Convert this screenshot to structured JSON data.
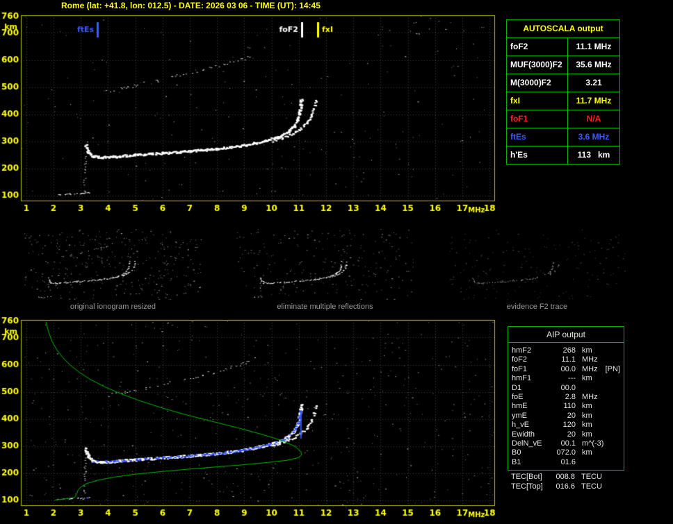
{
  "title": "Rome (lat: +41.8, lon: 012.5) - DATE: 2026 03 06 - TIME (UT): 14:45",
  "autoscala_table": {
    "header": "AUTOSCALA output",
    "rows": [
      {
        "param": "foF2",
        "value": "11.1 MHz",
        "color": "#ffffff"
      },
      {
        "param": "MUF(3000)F2",
        "value": "35.6 MHz",
        "color": "#ffffff"
      },
      {
        "param": "M(3000)F2",
        "value": "3.21",
        "color": "#ffffff"
      },
      {
        "param": "fxI",
        "value": "11.7 MHz",
        "color": "#ffff00"
      },
      {
        "param": "foF1",
        "value": "N/A",
        "color": "#ff2020"
      },
      {
        "param": "ftEs",
        "value": "3.6 MHz",
        "color": "#3b5bff"
      },
      {
        "param": "h'Es",
        "value": "113   km",
        "color": "#ffffff"
      }
    ]
  },
  "aip_table": {
    "header": "AIP output",
    "rows": [
      {
        "param": "hmF2",
        "value": "268",
        "unit": "km"
      },
      {
        "param": "foF2",
        "value": "11.1",
        "unit": "MHz"
      },
      {
        "param": "foF1",
        "value": "00.0",
        "unit": "MHz",
        "note": "[PN]"
      },
      {
        "param": "hmF1",
        "value": "---",
        "unit": "km"
      },
      {
        "param": "D1",
        "value": "00.0",
        "unit": ""
      },
      {
        "param": "foE",
        "value": "2.8",
        "unit": "MHz"
      },
      {
        "param": "hmE",
        "value": "110",
        "unit": "km"
      },
      {
        "param": "ymE",
        "value": "20",
        "unit": "km"
      },
      {
        "param": "h_vE",
        "value": "120",
        "unit": "km"
      },
      {
        "param": "Ewidth",
        "value": "20",
        "unit": "km"
      },
      {
        "param": "DelN_vE",
        "value": "00.1",
        "unit": "m^(-3)"
      },
      {
        "param": "B0",
        "value": "072.0",
        "unit": "km"
      },
      {
        "param": "B1",
        "value": "01.6",
        "unit": ""
      }
    ],
    "tec_rows": [
      {
        "param": "TEC[Bot]",
        "value": "008.8",
        "unit": "TECU"
      },
      {
        "param": "TEC[Top]",
        "value": "016.6",
        "unit": "TECU"
      }
    ]
  },
  "thumbnails": [
    {
      "caption": "original ionogram resized"
    },
    {
      "caption": "eliminate multiple reflections"
    },
    {
      "caption": "evidence F2 trace"
    }
  ],
  "trace_lib": {
    "o_trace": [
      [
        3.15,
        292
      ],
      [
        3.25,
        264
      ],
      [
        3.42,
        247
      ],
      [
        3.75,
        243
      ],
      [
        4.2,
        246
      ],
      [
        5.0,
        252
      ],
      [
        6.0,
        259
      ],
      [
        7.0,
        266
      ],
      [
        8.0,
        275
      ],
      [
        8.8,
        285
      ],
      [
        9.4,
        296
      ],
      [
        9.9,
        308
      ],
      [
        10.3,
        322
      ],
      [
        10.6,
        338
      ],
      [
        10.8,
        358
      ],
      [
        10.93,
        382
      ],
      [
        11.0,
        408
      ],
      [
        11.05,
        438
      ],
      [
        11.07,
        456
      ]
    ],
    "x_trace": [
      [
        10.0,
        303
      ],
      [
        10.4,
        316
      ],
      [
        10.75,
        331
      ],
      [
        11.05,
        349
      ],
      [
        11.28,
        370
      ],
      [
        11.44,
        395
      ],
      [
        11.54,
        424
      ],
      [
        11.6,
        452
      ]
    ],
    "second_hop": [
      [
        3.9,
        486
      ],
      [
        4.6,
        500
      ],
      [
        5.4,
        516
      ],
      [
        6.2,
        534
      ],
      [
        7.0,
        552
      ],
      [
        7.7,
        570
      ],
      [
        8.4,
        589
      ],
      [
        9.0,
        607
      ],
      [
        9.35,
        624
      ]
    ],
    "es_trace": [
      [
        2.15,
        106
      ],
      [
        2.6,
        108
      ],
      [
        3.05,
        110
      ],
      [
        3.35,
        113
      ]
    ],
    "es_vertical": [
      [
        3.1,
        102
      ],
      [
        3.14,
        200
      ],
      [
        3.18,
        296
      ]
    ],
    "blue_fit": [
      [
        3.4,
        245
      ],
      [
        4.2,
        246
      ],
      [
        5.0,
        252
      ],
      [
        6.0,
        259
      ],
      [
        7.0,
        266
      ],
      [
        8.0,
        275
      ],
      [
        8.8,
        285
      ],
      [
        9.4,
        296
      ],
      [
        9.9,
        308
      ],
      [
        10.3,
        322
      ],
      [
        10.6,
        338
      ],
      [
        10.8,
        358
      ],
      [
        10.93,
        382
      ],
      [
        11.0,
        408
      ],
      [
        11.04,
        430
      ]
    ],
    "blue_asymptote": [
      [
        11.08,
        328
      ],
      [
        11.08,
        432
      ]
    ],
    "blue_es": [
      [
        2.35,
        108
      ],
      [
        2.9,
        110
      ],
      [
        3.3,
        112
      ]
    ],
    "green_profile": [
      [
        1.72,
        758
      ],
      [
        1.82,
        720
      ],
      [
        1.95,
        685
      ],
      [
        2.12,
        655
      ],
      [
        2.35,
        625
      ],
      [
        2.62,
        598
      ],
      [
        2.95,
        572
      ],
      [
        3.35,
        546
      ],
      [
        3.85,
        520
      ],
      [
        4.45,
        494
      ],
      [
        5.15,
        468
      ],
      [
        5.95,
        442
      ],
      [
        6.85,
        416
      ],
      [
        7.8,
        392
      ],
      [
        8.75,
        368
      ],
      [
        9.6,
        345
      ],
      [
        10.35,
        322
      ],
      [
        10.85,
        300
      ],
      [
        11.08,
        280
      ],
      [
        11.1,
        268
      ],
      [
        11.0,
        258
      ],
      [
        10.55,
        248
      ],
      [
        9.85,
        240
      ],
      [
        9.0,
        232
      ],
      [
        8.0,
        224
      ],
      [
        7.0,
        216
      ],
      [
        6.0,
        207
      ],
      [
        5.0,
        197
      ],
      [
        4.2,
        186
      ],
      [
        3.6,
        174
      ],
      [
        3.2,
        162
      ],
      [
        3.0,
        150
      ],
      [
        2.9,
        138
      ],
      [
        2.85,
        125
      ],
      [
        2.78,
        112
      ],
      [
        2.45,
        106
      ],
      [
        2.05,
        102
      ]
    ]
  },
  "chart_data": [
    {
      "id": "main_ionogram",
      "type": "scatter",
      "title": "scaled ionogram with AUTOSCALA characteristics",
      "xlabel": "MHz",
      "ylabel": "km",
      "xlim": [
        0.8,
        18.2
      ],
      "ylim": [
        80,
        765
      ],
      "x_ticks": [
        1,
        2,
        3,
        4,
        5,
        6,
        7,
        8,
        9,
        10,
        11,
        12,
        13,
        14,
        15,
        16,
        17,
        18
      ],
      "y_grid": [
        100,
        200,
        300,
        400,
        500,
        600,
        700
      ],
      "y_labels": [
        760,
        700,
        600,
        500,
        400,
        300,
        200,
        100
      ],
      "grid_color": "#46463c",
      "border_color": "#bcbc00",
      "axis_color": "#ffff00",
      "margins": {
        "l": 30,
        "t": 6,
        "r": 13,
        "b": 26
      },
      "seed": 7,
      "markers": [
        {
          "label": "ftEs",
          "freq": 3.6,
          "color": "#3b5bff",
          "side": "left"
        },
        {
          "label": "foF2",
          "freq": 11.1,
          "color": "#ffffff",
          "side": "left"
        },
        {
          "label": "fxI",
          "freq": 11.7,
          "color": "#ffff00",
          "side": "right"
        }
      ],
      "series": [
        {
          "name": "background-noise",
          "style": "noise",
          "color": "#808080",
          "count": 170
        },
        {
          "name": "background-noise-bright",
          "style": "noise",
          "color": "#d0d0d0",
          "count": 45
        },
        {
          "name": "second-hop-echo",
          "ref": "second_hop",
          "color": "#d8d8d8",
          "size": 2,
          "density": 0.38,
          "jitter": 2.2
        },
        {
          "name": "sporadic-e-trace",
          "ref": "es_trace",
          "color": "#ffffff",
          "size": 2,
          "density": 0.75,
          "jitter": 0.8
        },
        {
          "name": "vertical-scatter",
          "ref": "es_vertical",
          "color": "#cccccc",
          "size": 2,
          "density": 0.4,
          "jitter": 1.8
        },
        {
          "name": "f2-ordinary-trace",
          "ref": "o_trace",
          "color": "#ffffff",
          "size": 3,
          "density": 0.95,
          "jitter": 1.6,
          "passes": 2
        },
        {
          "name": "f2-extraordinary-trace",
          "ref": "x_trace",
          "color": "#ffffff",
          "size": 3,
          "density": 0.85,
          "jitter": 1.4
        }
      ]
    },
    {
      "id": "thumb_original",
      "type": "scatter",
      "title": "original ionogram resized",
      "xlim": [
        0.8,
        18.2
      ],
      "ylim": [
        80,
        765
      ],
      "margins": {
        "l": 0,
        "t": 0,
        "r": 0,
        "b": 0
      },
      "seed": 21,
      "series": [
        {
          "name": "background-noise",
          "style": "noise",
          "color": "#7a7a7a",
          "count": 260
        },
        {
          "name": "background-noise-bright",
          "style": "noise",
          "color": "#c8c8c8",
          "count": 60
        },
        {
          "name": "second-hop-echo",
          "ref": "second_hop",
          "color": "#cfcfcf",
          "size": 1,
          "density": 0.4,
          "jitter": 1.2
        },
        {
          "name": "sporadic-e-trace",
          "ref": "es_trace",
          "color": "#ffffff",
          "size": 1,
          "density": 0.6,
          "jitter": 0.8
        },
        {
          "name": "vertical-scatter",
          "ref": "es_vertical",
          "color": "#cfcfcf",
          "size": 1,
          "density": 0.35,
          "jitter": 1
        },
        {
          "name": "f2-ordinary-trace",
          "ref": "o_trace",
          "color": "#ffffff",
          "size": 2,
          "density": 0.85,
          "jitter": 1
        },
        {
          "name": "f2-extraordinary-trace",
          "ref": "x_trace",
          "color": "#ffffff",
          "size": 2,
          "density": 0.7,
          "jitter": 1
        }
      ]
    },
    {
      "id": "thumb_filtered",
      "type": "scatter",
      "title": "eliminate multiple reflections",
      "xlim": [
        0.8,
        18.2
      ],
      "ylim": [
        80,
        765
      ],
      "margins": {
        "l": 0,
        "t": 0,
        "r": 0,
        "b": 0
      },
      "seed": 22,
      "series": [
        {
          "name": "background-noise",
          "style": "noise",
          "color": "#6f6f6f",
          "count": 180
        },
        {
          "name": "background-noise-bright",
          "style": "noise",
          "color": "#c0c0c0",
          "count": 40
        },
        {
          "name": "sporadic-e-trace",
          "ref": "es_trace",
          "color": "#ffffff",
          "size": 1,
          "density": 0.55,
          "jitter": 0.8
        },
        {
          "name": "vertical-scatter",
          "ref": "es_vertical",
          "color": "#bbbbbb",
          "size": 1,
          "density": 0.25,
          "jitter": 1
        },
        {
          "name": "f2-ordinary-trace",
          "ref": "o_trace",
          "color": "#ffffff",
          "size": 2,
          "density": 0.85,
          "jitter": 1
        },
        {
          "name": "f2-extraordinary-trace",
          "ref": "x_trace",
          "color": "#ffffff",
          "size": 2,
          "density": 0.7,
          "jitter": 1
        }
      ]
    },
    {
      "id": "thumb_f2",
      "type": "scatter",
      "title": "evidence F2 trace",
      "xlim": [
        0.8,
        18.2
      ],
      "ylim": [
        80,
        765
      ],
      "margins": {
        "l": 0,
        "t": 0,
        "r": 0,
        "b": 0
      },
      "seed": 23,
      "series": [
        {
          "name": "background-noise",
          "style": "noise",
          "color": "#4a4a4a",
          "count": 160
        },
        {
          "name": "f2-ordinary-trace",
          "ref": "o_trace",
          "color": "#d8d8d8",
          "size": 1,
          "density": 0.55,
          "jitter": 1
        },
        {
          "name": "f2-extraordinary-trace",
          "ref": "x_trace",
          "color": "#d8d8d8",
          "size": 1,
          "density": 0.45,
          "jitter": 1
        }
      ]
    },
    {
      "id": "profile_ionogram",
      "type": "scatter",
      "title": "ionogram with restored trace and electron density profile",
      "xlabel": "MHz",
      "ylabel": "km",
      "xlim": [
        0.8,
        18.2
      ],
      "ylim": [
        80,
        765
      ],
      "x_ticks": [
        1,
        2,
        3,
        4,
        5,
        6,
        7,
        8,
        9,
        10,
        11,
        12,
        13,
        14,
        15,
        16,
        17,
        18
      ],
      "y_grid": [
        100,
        200,
        300,
        400,
        500,
        600,
        700
      ],
      "y_labels": [
        760,
        700,
        600,
        500,
        400,
        300,
        200,
        100
      ],
      "grid_color": "#46463c",
      "border_color": "#bcbc00",
      "axis_color": "#ffff00",
      "margins": {
        "l": 30,
        "t": 6,
        "r": 13,
        "b": 26
      },
      "seed": 99,
      "series": [
        {
          "name": "background-noise",
          "style": "noise",
          "color": "#777777",
          "count": 420
        },
        {
          "name": "background-noise-bright",
          "style": "noise",
          "color": "#cccccc",
          "count": 80
        },
        {
          "name": "second-hop-echo",
          "ref": "second_hop",
          "color": "#d8d8d8",
          "size": 2,
          "density": 0.35,
          "jitter": 2.2
        },
        {
          "name": "sporadic-e-trace",
          "ref": "es_trace",
          "color": "#ffffff",
          "size": 2,
          "density": 0.7,
          "jitter": 0.8
        },
        {
          "name": "vertical-scatter",
          "ref": "es_vertical",
          "color": "#cccccc",
          "size": 2,
          "density": 0.4,
          "jitter": 1.8
        },
        {
          "name": "f2-ordinary-trace",
          "ref": "o_trace",
          "color": "#ffffff",
          "size": 3,
          "density": 0.95,
          "jitter": 1.6,
          "passes": 2
        },
        {
          "name": "f2-extraordinary-trace",
          "ref": "x_trace",
          "color": "#ffffff",
          "size": 3,
          "density": 0.8,
          "jitter": 1.4
        },
        {
          "name": "autoscala-restored-trace",
          "ref": "blue_fit",
          "color": "#2e4bff",
          "size": 3,
          "density": 0.6,
          "jitter": 1.2
        },
        {
          "name": "restored-trace-asymptote",
          "ref": "blue_asymptote",
          "style": "line",
          "color": "#2e4bff",
          "width": 2
        },
        {
          "name": "sporadic-e-restored",
          "ref": "blue_es",
          "color": "#2e4bff",
          "size": 2,
          "density": 0.45,
          "jitter": 0.8
        },
        {
          "name": "electron-density-profile",
          "ref": "green_profile",
          "style": "line",
          "color": "#00bb00",
          "width": 1
        }
      ]
    }
  ]
}
